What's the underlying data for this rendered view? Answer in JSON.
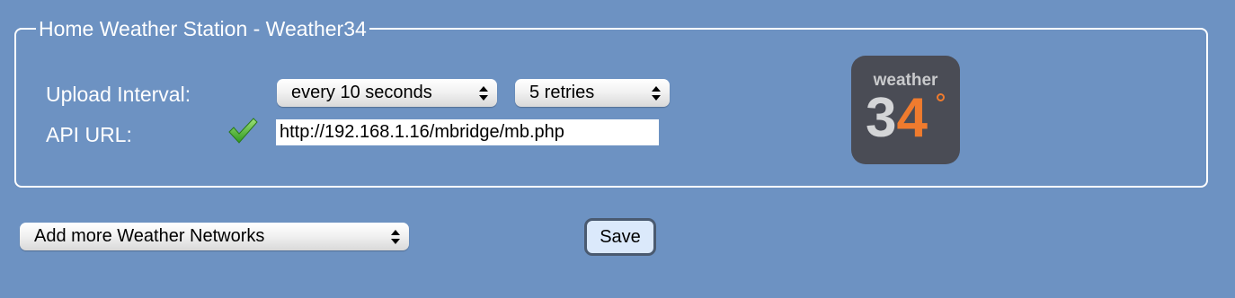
{
  "fieldset": {
    "legend": "Home Weather Station - Weather34"
  },
  "upload_interval": {
    "label": "Upload Interval:",
    "interval_selected": "every 10 seconds",
    "retries_selected": "5 retries"
  },
  "api_url": {
    "label": "API URL:",
    "value": "http://192.168.1.16/mbridge/mb.php",
    "status_icon": "green-check-icon"
  },
  "logo": {
    "word": "weather",
    "number_first": "3",
    "number_second": "4",
    "colors": {
      "background": "#4a4c55",
      "accent": "#ef7b2e"
    }
  },
  "networks_select": {
    "selected": "Add more Weather Networks"
  },
  "save_button": {
    "label": "Save"
  },
  "colors": {
    "page_background": "#6d92c2",
    "border": "#ffffff",
    "check_green": "#4caf32"
  }
}
